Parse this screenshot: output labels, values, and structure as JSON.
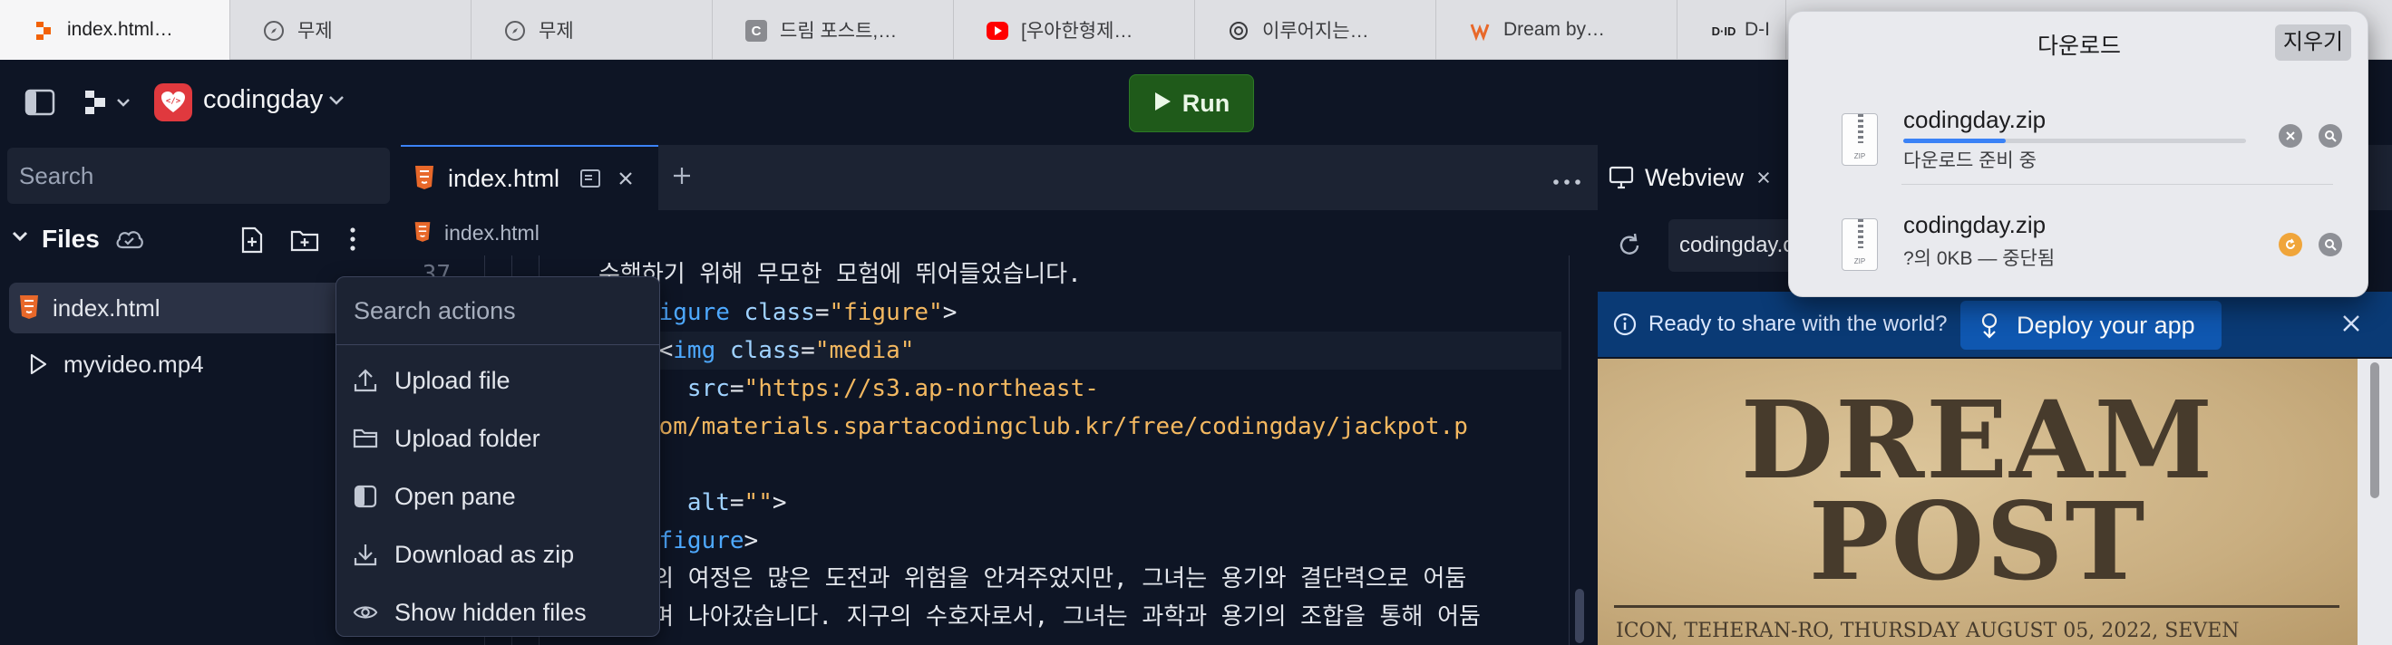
{
  "browser": {
    "tabs": [
      {
        "title": "index.html…",
        "icon": "replit-icon",
        "active": true
      },
      {
        "title": "무제",
        "icon": "compass-icon"
      },
      {
        "title": "무제",
        "icon": "compass-icon"
      },
      {
        "title": "드림 포스트,…",
        "icon": "c-logo-icon"
      },
      {
        "title": "[우아한형제…",
        "icon": "youtube-icon"
      },
      {
        "title": "이루어지는…",
        "icon": "chatgpt-icon"
      },
      {
        "title": "Dream by…",
        "icon": "wombo-icon"
      },
      {
        "title": "D-I",
        "icon": "did-icon"
      }
    ]
  },
  "app": {
    "project_name": "codingday",
    "run_label": "Run"
  },
  "sidebar": {
    "search_placeholder": "Search",
    "files_title": "Files",
    "files": [
      {
        "name": "index.html",
        "selected": true
      },
      {
        "name": "myvideo.mp4",
        "selected": false
      }
    ]
  },
  "editor": {
    "tab_title": "index.html",
    "breadcrumb": "index.html",
    "lines": [
      {
        "num": "37",
        "text": "수행하기 위해 무모한 모험에 뛰어들었습니다."
      },
      {
        "num": "",
        "parts": [
          [
            "",
            "  <"
          ],
          [
            "tag",
            "figure"
          ],
          [
            "attr",
            " class"
          ],
          [
            "",
            "="
          ],
          [
            "str",
            "\"figure\""
          ],
          [
            "",
            ">"
          ]
        ]
      },
      {
        "num": "",
        "parts": [
          [
            "",
            "    <"
          ],
          [
            "tag",
            "img"
          ],
          [
            "attr",
            " class"
          ],
          [
            "",
            "="
          ],
          [
            "str",
            "\"media\""
          ]
        ]
      },
      {
        "num": "",
        "parts": [
          [
            "attr",
            "      src"
          ],
          [
            "",
            "="
          ],
          [
            "str",
            "\"https://s3.ap-northeast-"
          ]
        ]
      },
      {
        "num": "",
        "parts": [
          [
            "str",
            "  .com/materials.spartacodingclub.kr/free/codingday/jackpot.p"
          ]
        ]
      },
      {
        "num": "",
        "parts": [
          [
            "",
            ""
          ]
        ]
      },
      {
        "num": "",
        "parts": [
          [
            "attr",
            "      alt"
          ],
          [
            "",
            "="
          ],
          [
            "str",
            "\"\""
          ],
          [
            "",
            ">"
          ]
        ]
      },
      {
        "num": "",
        "parts": [
          [
            "",
            "  </"
          ],
          [
            "tag",
            "figure"
          ],
          [
            "",
            ">"
          ]
        ]
      },
      {
        "num": "",
        "text": "  시의 여정은 많은 도전과 위험을 안겨주었지만, 그녀는 용기와 결단력으로 어둠"
      },
      {
        "num": "",
        "text": "  내며 나아갔습니다. 지구의 수호자로서, 그녀는 과학과 용기의 조합을 통해 어둠"
      }
    ]
  },
  "menu": {
    "search_placeholder": "Search actions",
    "items": [
      {
        "label": "Upload file",
        "icon": "upload-icon"
      },
      {
        "label": "Upload folder",
        "icon": "folder-icon"
      },
      {
        "label": "Open pane",
        "icon": "pane-icon"
      },
      {
        "label": "Download as zip",
        "icon": "download-icon"
      },
      {
        "label": "Show hidden files",
        "icon": "eye-icon"
      }
    ]
  },
  "webview": {
    "tab_title": "Webview",
    "url": "codingday.c",
    "banner_text": "Ready to share with the world?",
    "deploy_label": "Deploy your app",
    "poster_line1": "DREAM",
    "poster_line2": "POST",
    "poster_caption": "ICON, TEHERAN-RO, THURSDAY AUGUST 05, 2022, SEVEN"
  },
  "downloads": {
    "title": "다운로드",
    "clear_label": "지우기",
    "items": [
      {
        "name": "codingday.zip",
        "status": "다운로드 준비 중",
        "progress": 0.3
      },
      {
        "name": "codingday.zip",
        "status": "?의 0KB — 중단됨"
      }
    ]
  },
  "colors": {
    "app_bg": "#0e1525",
    "panel_bg": "#1c2333",
    "accent_blue": "#3b82f6",
    "run_green": "#1f5a1a",
    "html_orange": "#e8682a"
  }
}
